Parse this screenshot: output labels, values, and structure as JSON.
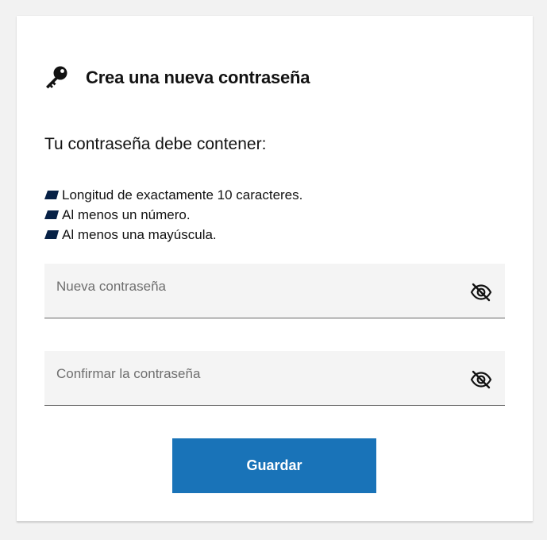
{
  "page": {
    "title": "Crea una nueva contraseña",
    "subtitle": "Tu contraseña debe contener:",
    "requirements": [
      "Longitud de exactamente 10 caracteres.",
      "Al menos un número.",
      "Al menos una mayúscula."
    ]
  },
  "form": {
    "new_password": {
      "placeholder": "Nueva contraseña",
      "value": ""
    },
    "confirm_password": {
      "placeholder": "Confirmar la contraseña",
      "value": ""
    },
    "submit_label": "Guardar"
  },
  "icons": {
    "header": "key-icon",
    "bullet": "bullet-marker-icon",
    "toggle": "eye-slash-icon"
  },
  "colors": {
    "accent": "#1973b8",
    "bullet": "#072146",
    "field_bg": "#f4f4f4",
    "page_bg": "#f2f2f2"
  }
}
